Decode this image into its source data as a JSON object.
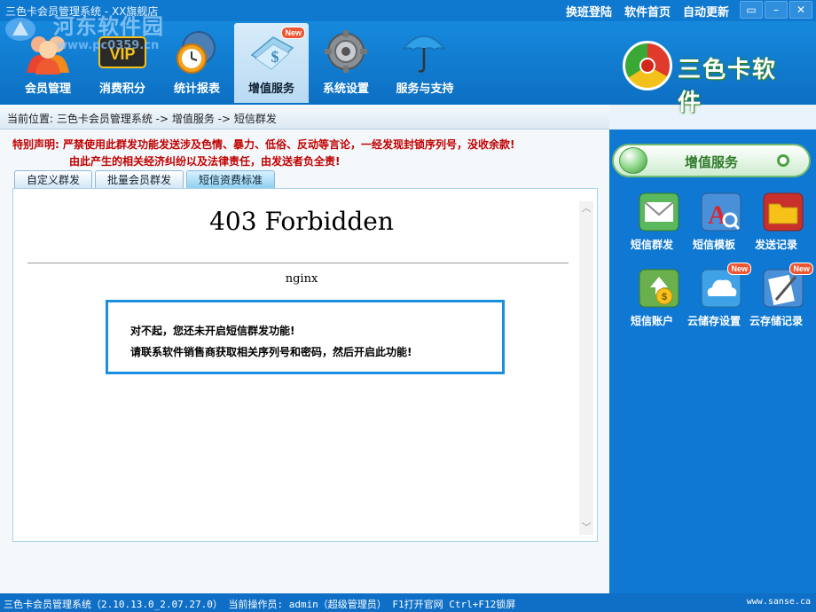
{
  "window": {
    "title": "三色卡会员管理系统 - XX旗舰店",
    "links": [
      "换班登陆",
      "软件首页",
      "自动更新"
    ],
    "controls": [
      "▭",
      "–",
      "✕"
    ]
  },
  "watermark": {
    "text": "河东软件园",
    "url": "www.pc0359.cn"
  },
  "nav": {
    "items": [
      {
        "label": "会员管理",
        "icon": "members-icon"
      },
      {
        "label": "消费积分",
        "icon": "vip-card-icon"
      },
      {
        "label": "统计报表",
        "icon": "clock-chart-icon"
      },
      {
        "label": "增值服务",
        "icon": "value-added-icon",
        "active": true,
        "badge": "New"
      },
      {
        "label": "系统设置",
        "icon": "gear-icon"
      },
      {
        "label": "服务与支持",
        "icon": "umbrella-icon"
      }
    ]
  },
  "brand": {
    "name": "三色卡软件"
  },
  "breadcrumb": {
    "text": "当前位置: 三色卡会员管理系统 -> 增值服务 -> 短信群发"
  },
  "notice": {
    "line1": "特别声明: 严禁使用此群发功能发送涉及色情、暴力、低俗、反动等言论，一经发现封锁序列号，没收余款!",
    "line2": "由此产生的相关经济纠纷以及法律责任，由发送者负全责!"
  },
  "tabs": [
    {
      "label": "自定义群发"
    },
    {
      "label": "批量会员群发"
    },
    {
      "label": "短信资费标准",
      "active": true
    }
  ],
  "content": {
    "error_title": "403 Forbidden",
    "server": "nginx",
    "message_line1": "对不起，您还未开启短信群发功能!",
    "message_line2": "请联系软件销售商获取相关序列号和密码，然后开启此功能!"
  },
  "right_panel": {
    "title": "增值服务",
    "functions": [
      {
        "label": "短信群发",
        "icon": "envelope-icon"
      },
      {
        "label": "短信模板",
        "icon": "template-icon"
      },
      {
        "label": "发送记录",
        "icon": "folder-icon"
      },
      {
        "label": "短信账户",
        "icon": "account-icon"
      },
      {
        "label": "云储存设置",
        "icon": "cloud-icon",
        "badge": "New"
      },
      {
        "label": "云存储记录",
        "icon": "note-icon",
        "badge": "New"
      }
    ]
  },
  "statusbar": {
    "text": "三色卡会员管理系统（2.10.13.0_2.07.27.0） 当前操作员: admin（超级管理员） F1打开官网 Ctrl+F12锁屏",
    "url": "www.sanse.ca"
  },
  "colors": {
    "title_bar": "#0f78cf",
    "right_panel": "#0f78d2",
    "notice_red": "#c00000",
    "msg_border": "#1a8fe0"
  }
}
